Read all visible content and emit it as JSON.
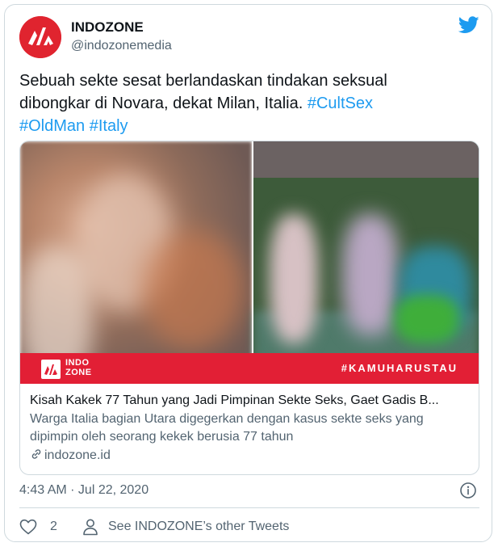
{
  "account": {
    "name": "INDOZONE",
    "handle": "@indozonemedia"
  },
  "tweet": {
    "text_line1": "Sebuah sekte sesat berlandaskan tindakan seksual",
    "text_line2_plain": "dibongkar di Novara, dekat Milan, Italia. ",
    "hashtags": [
      "#CultSex",
      "#OldMan",
      "#Italy"
    ]
  },
  "link_card": {
    "banner_brand_line1": "INDO",
    "banner_brand_line2": "ZONE",
    "banner_hashtag": "#KAMUHARUSTAU",
    "title": "Kisah Kakek 77 Tahun yang Jadi Pimpinan Sekte Seks, Gaet Gadis B...",
    "description": "Warga Italia bagian Utara digegerkan dengan kasus sekte seks yang dipimpin oleh seorang kekek berusia 77 tahun",
    "domain": "indozone.id"
  },
  "meta": {
    "timestamp": "4:43 AM · Jul 22, 2020"
  },
  "actions": {
    "like_count": "2",
    "see_tweets_label": "See INDOZONE’s other Tweets"
  },
  "colors": {
    "brand_red": "#e0242f",
    "twitter_blue": "#1d9bf0",
    "secondary_text": "#536471"
  },
  "icons": {
    "bird": "twitter-bird-icon",
    "info": "info-icon",
    "heart": "heart-icon",
    "person": "person-icon",
    "link": "link-icon"
  }
}
